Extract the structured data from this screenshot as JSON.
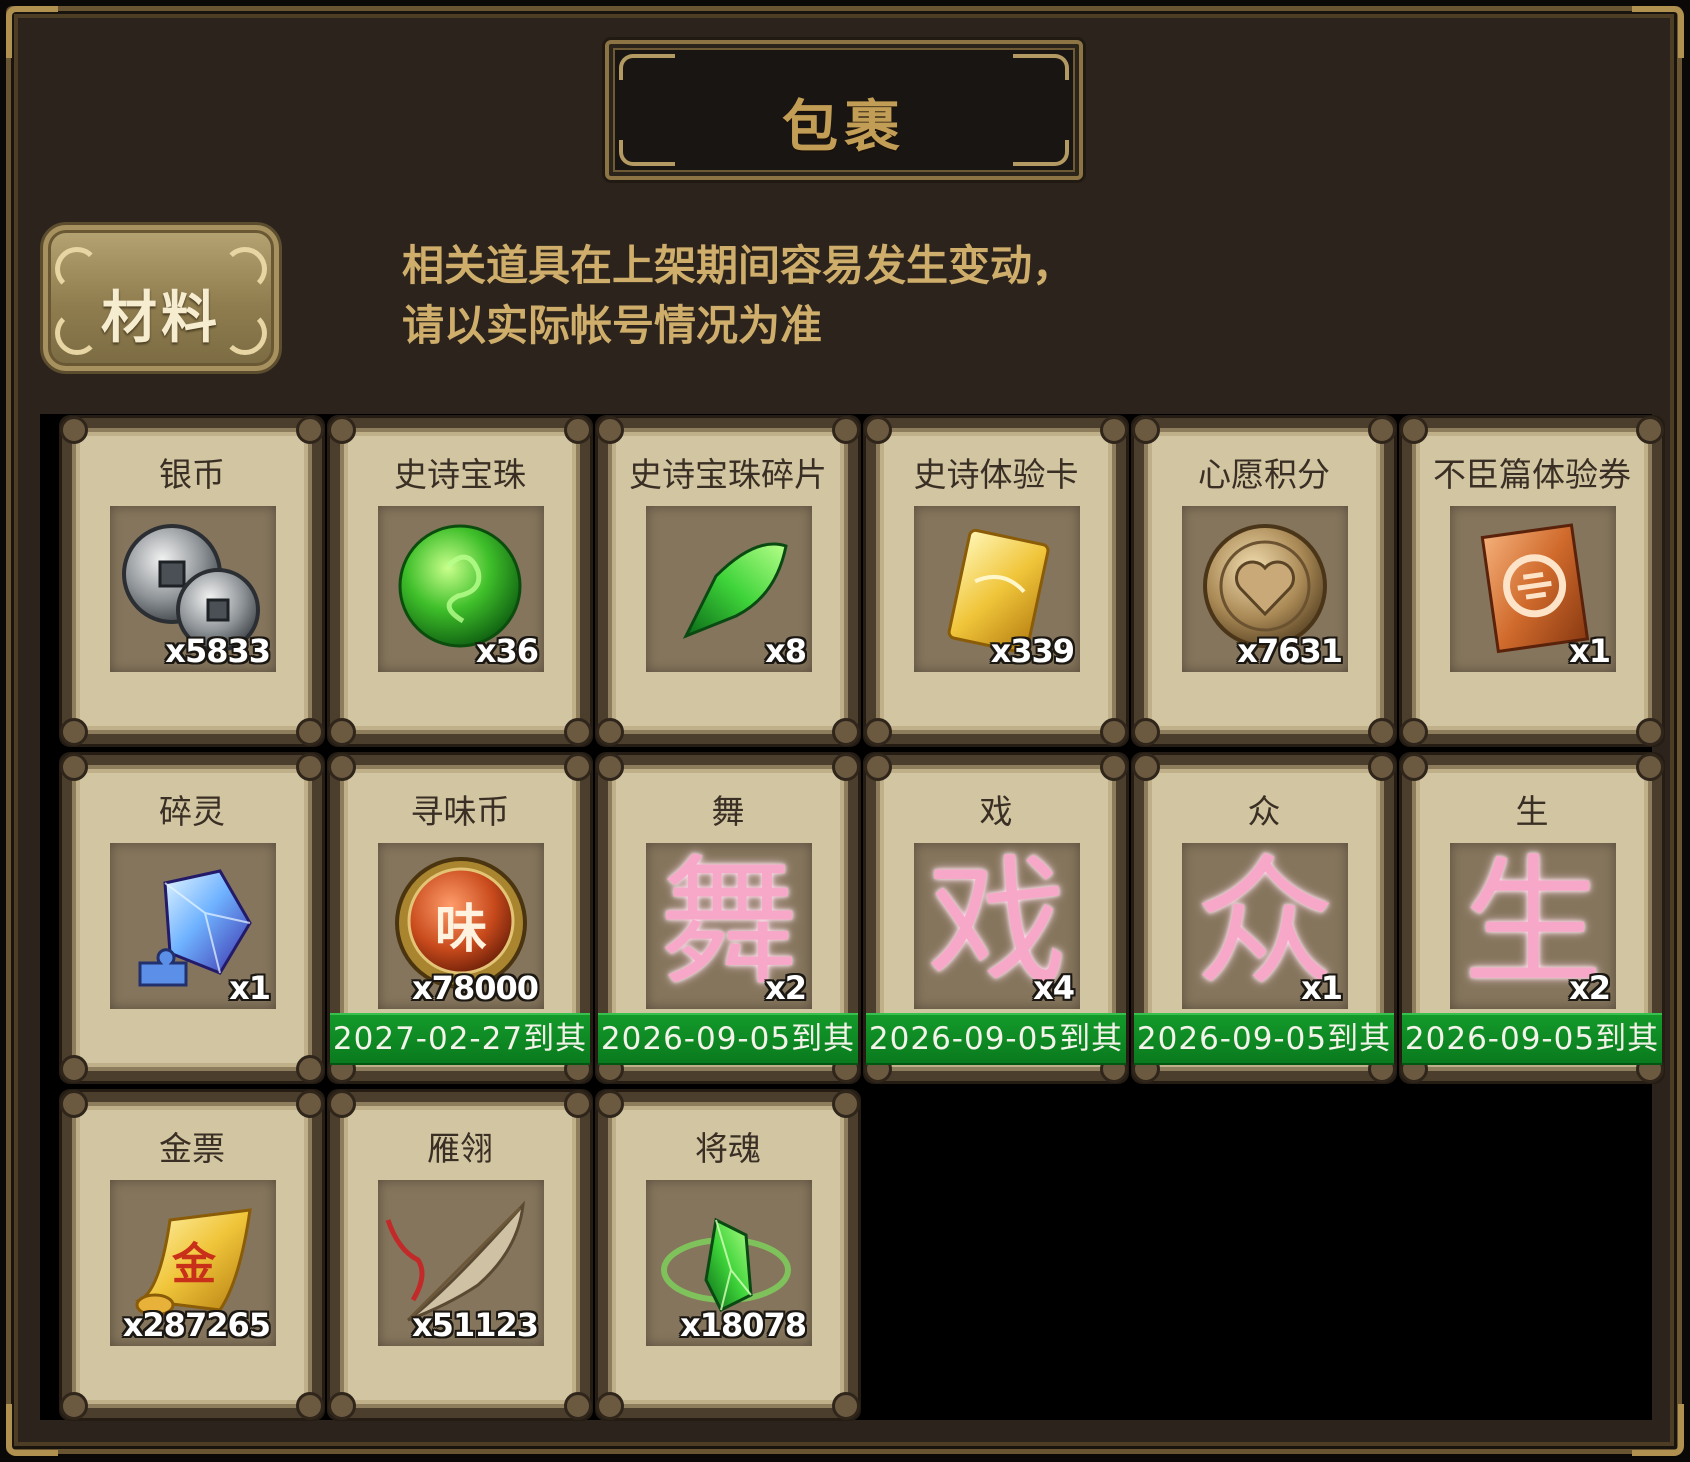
{
  "title": "包裹",
  "tab": {
    "label": "材料"
  },
  "notice": {
    "line1": "相关道具在上架期间容易发生变动，",
    "line2": "请以实际帐号情况为准"
  },
  "items": [
    {
      "name": "银币",
      "icon": "silver-coins-icon",
      "qty": "x5833"
    },
    {
      "name": "史诗宝珠",
      "icon": "green-orb-icon",
      "qty": "x36"
    },
    {
      "name": "史诗宝珠碎片",
      "icon": "green-shard-icon",
      "qty": "x8"
    },
    {
      "name": "史诗体验卡",
      "icon": "gold-card-icon",
      "qty": "x339"
    },
    {
      "name": "心愿积分",
      "icon": "heart-coin-icon",
      "qty": "x7631"
    },
    {
      "name": "不臣篇体验券",
      "icon": "orange-ticket-icon",
      "qty": "x1"
    },
    {
      "name": "碎灵",
      "icon": "blue-crystal-puzzle-icon",
      "qty": "x1"
    },
    {
      "name": "寻味币",
      "icon": "wei-coin-icon",
      "qty": "x78000",
      "coin_char": "味",
      "expiry": "2027-02-27到其"
    },
    {
      "name": "舞",
      "icon": "pink-character-icon",
      "glyph": "舞",
      "qty": "x2",
      "expiry": "2026-09-05到其"
    },
    {
      "name": "戏",
      "icon": "pink-character-icon",
      "glyph": "戏",
      "qty": "x4",
      "expiry": "2026-09-05到其"
    },
    {
      "name": "众",
      "icon": "pink-character-icon",
      "glyph": "众",
      "qty": "x1",
      "expiry": "2026-09-05到其"
    },
    {
      "name": "生",
      "icon": "pink-character-icon",
      "glyph": "生",
      "qty": "x2",
      "expiry": "2026-09-05到其"
    },
    {
      "name": "金票",
      "icon": "gold-scroll-icon",
      "qty": "x287265",
      "scroll_char": "金"
    },
    {
      "name": "雁翎",
      "icon": "feather-icon",
      "qty": "x51123"
    },
    {
      "name": "将魂",
      "icon": "green-soul-crystal-icon",
      "qty": "x18078"
    }
  ],
  "colors": {
    "expiry_bar": "#0f8a24",
    "title_text": "#c29d55",
    "notice_text": "#cfae6b",
    "glyph_pink": "#f7a8c8"
  }
}
